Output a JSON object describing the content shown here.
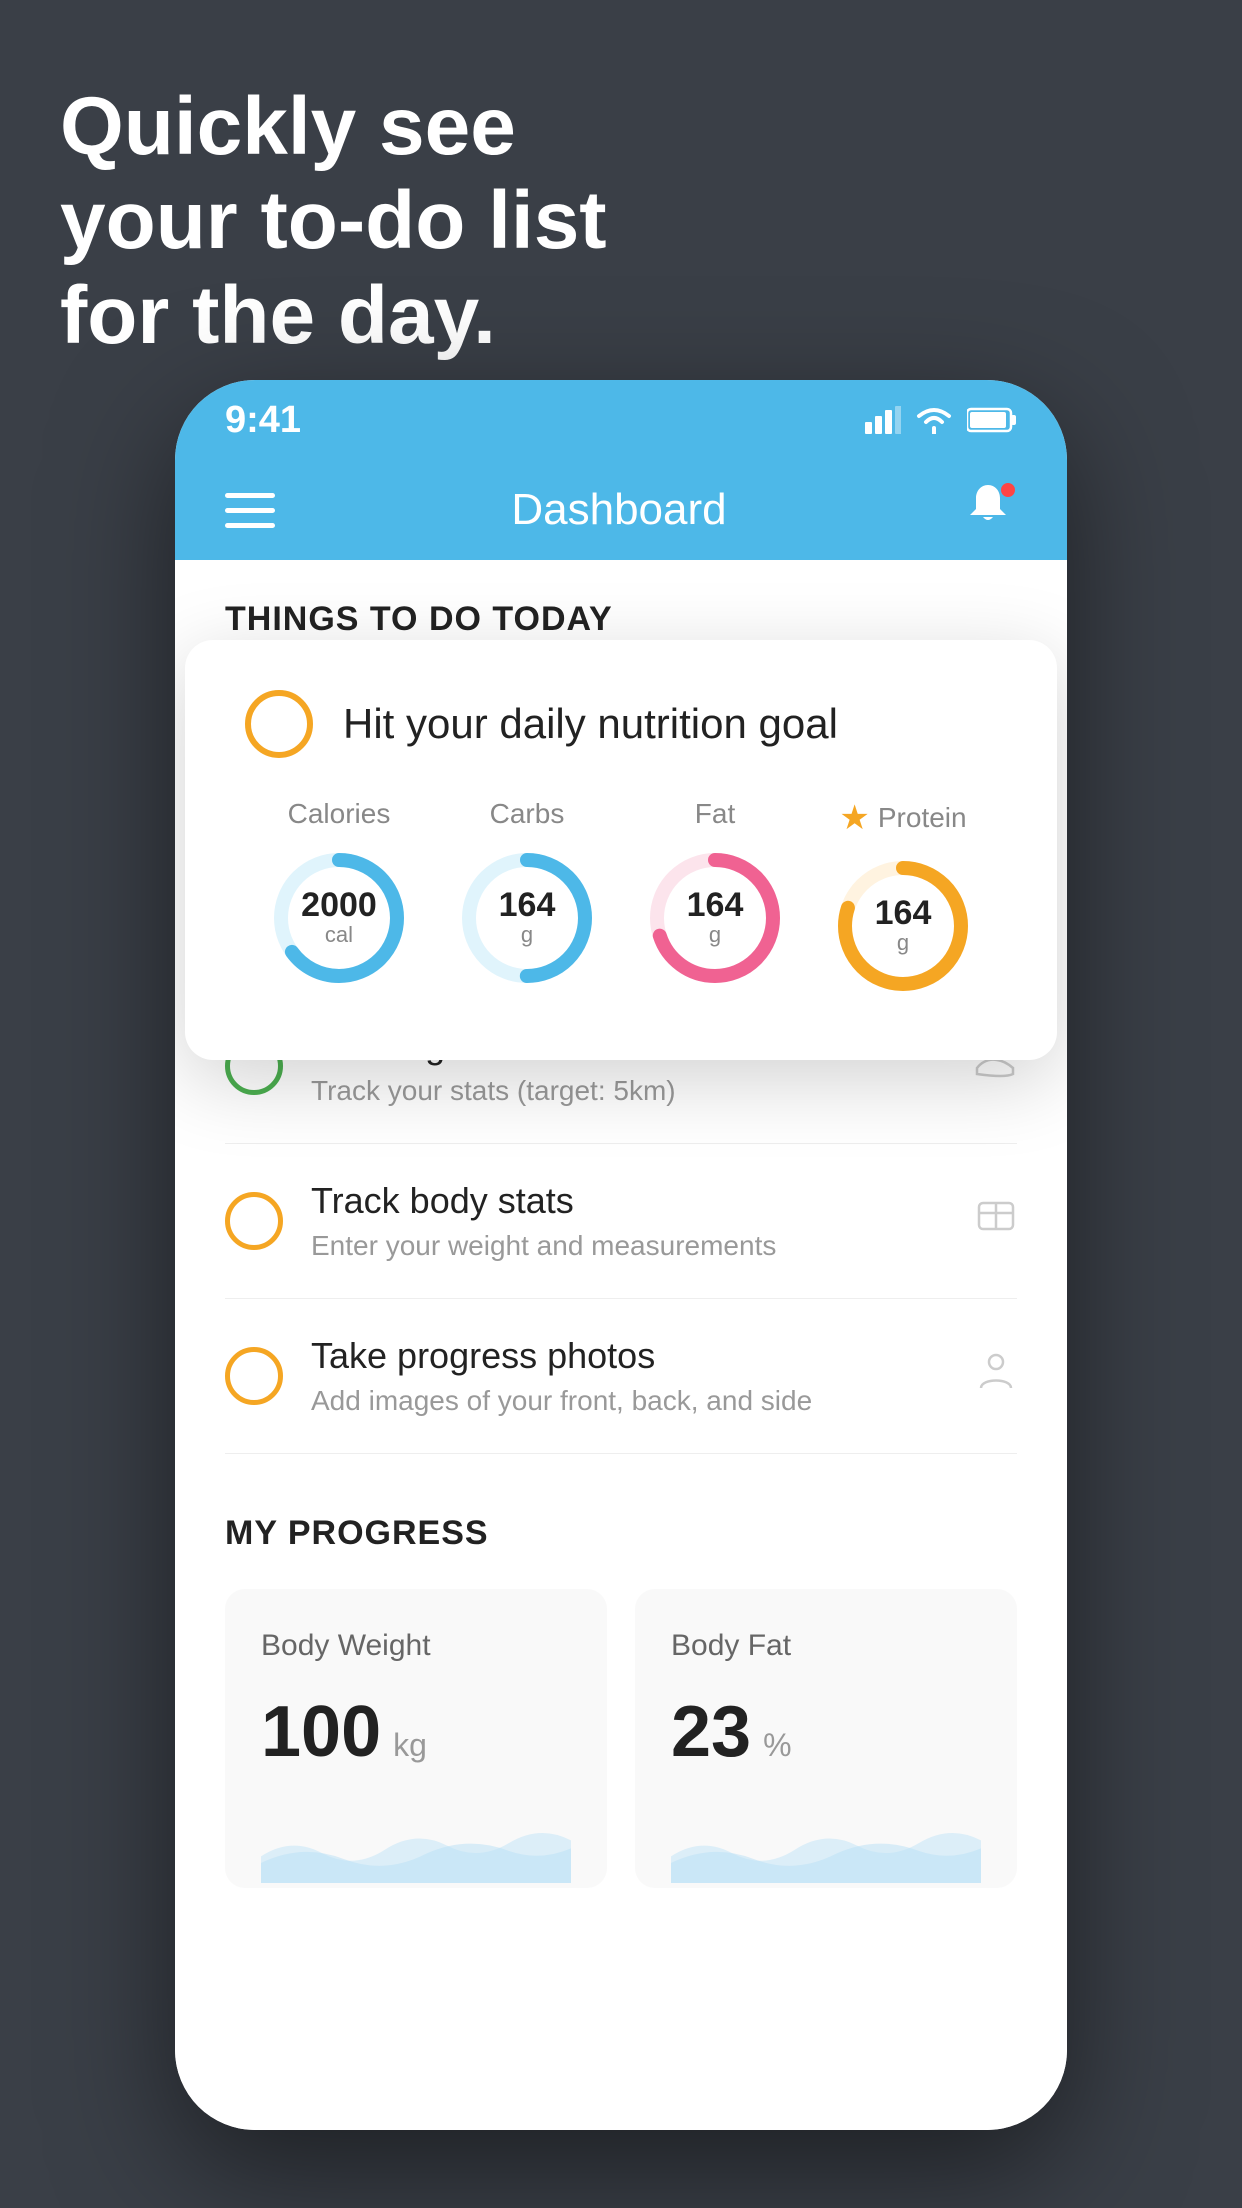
{
  "headline": {
    "line1": "Quickly see",
    "line2": "your to-do list",
    "line3": "for the day."
  },
  "phone": {
    "statusBar": {
      "time": "9:41",
      "signal": "▐▐▐▐",
      "wifi": "wifi",
      "battery": "battery"
    },
    "navBar": {
      "title": "Dashboard"
    },
    "sectionHeader": "THINGS TO DO TODAY",
    "nutritionCard": {
      "title": "Hit your daily nutrition goal",
      "items": [
        {
          "label": "Calories",
          "value": "2000",
          "unit": "cal",
          "color": "#4db8e8",
          "trackColor": "#e0f4fc",
          "percent": 65
        },
        {
          "label": "Carbs",
          "value": "164",
          "unit": "g",
          "color": "#4db8e8",
          "trackColor": "#e0f4fc",
          "percent": 50
        },
        {
          "label": "Fat",
          "value": "164",
          "unit": "g",
          "color": "#f06292",
          "trackColor": "#fce4ec",
          "percent": 70
        },
        {
          "label": "Protein",
          "value": "164",
          "unit": "g",
          "color": "#f5a623",
          "trackColor": "#fff3e0",
          "percent": 80,
          "star": true
        }
      ]
    },
    "listItems": [
      {
        "title": "Running",
        "subtitle": "Track your stats (target: 5km)",
        "circleColor": "green",
        "icon": "shoe"
      },
      {
        "title": "Track body stats",
        "subtitle": "Enter your weight and measurements",
        "circleColor": "yellow",
        "icon": "scale"
      },
      {
        "title": "Take progress photos",
        "subtitle": "Add images of your front, back, and side",
        "circleColor": "yellow",
        "icon": "person"
      }
    ],
    "progressSection": {
      "header": "MY PROGRESS",
      "cards": [
        {
          "title": "Body Weight",
          "value": "100",
          "unit": "kg"
        },
        {
          "title": "Body Fat",
          "value": "23",
          "unit": "%"
        }
      ]
    }
  },
  "colors": {
    "background": "#3a3f47",
    "navBlue": "#4db8e8",
    "accentGreen": "#4caf50",
    "accentYellow": "#f5a623",
    "accentPink": "#f06292"
  }
}
